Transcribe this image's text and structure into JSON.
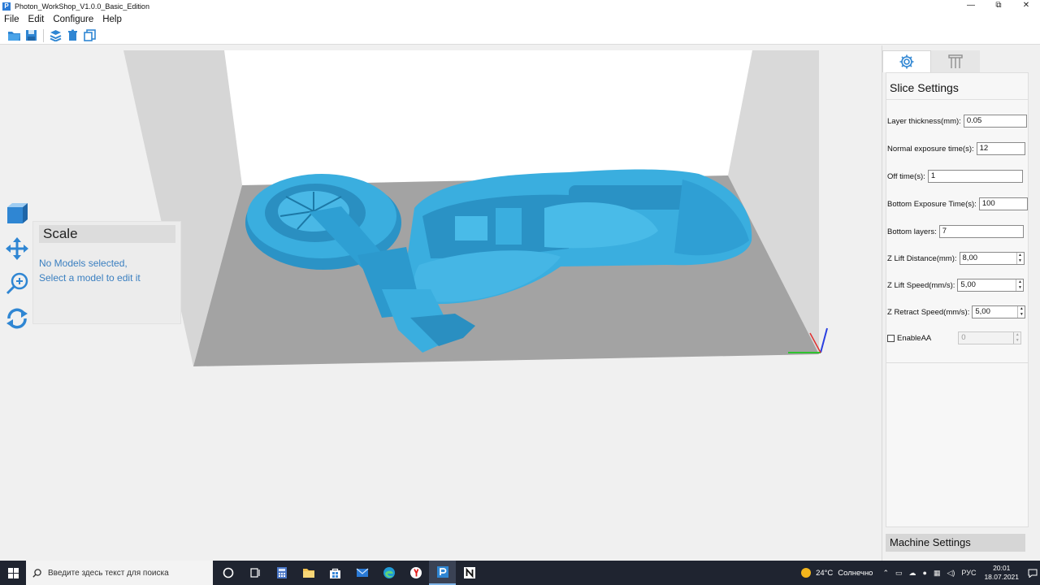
{
  "window": {
    "title": "Photon_WorkShop_V1.0.0_Basic_Edition",
    "app_icon_letter": "P",
    "controls": {
      "minimize": "—",
      "restore": "⧉",
      "close": "✕"
    }
  },
  "menu": {
    "items": [
      "File",
      "Edit",
      "Configure",
      "Help"
    ]
  },
  "toolbar": {
    "icons": [
      "open-folder-icon",
      "save-icon",
      "slice-layers-icon",
      "delete-icon",
      "copy-icon"
    ]
  },
  "left_tools": {
    "icons": [
      "cube-view-icon",
      "move-icon",
      "scale-icon",
      "rotate-icon"
    ]
  },
  "scale_panel": {
    "title": "Scale",
    "message_line1": "No Models selected,",
    "message_line2": "Select a model to edit it"
  },
  "right_panel": {
    "tabs": [
      {
        "icon": "gear-icon",
        "active": true
      },
      {
        "icon": "support-icon",
        "active": false
      }
    ],
    "title": "Slice Settings",
    "fields": {
      "layer_thickness": {
        "label": "Layer thickness(mm):",
        "value": "0.05"
      },
      "normal_exposure": {
        "label": "Normal exposure time(s):",
        "value": "12"
      },
      "off_time": {
        "label": "Off time(s):",
        "value": "1"
      },
      "bottom_exposure": {
        "label": "Bottom Exposure Time(s):",
        "value": "100"
      },
      "bottom_layers": {
        "label": "Bottom layers:",
        "value": "7"
      },
      "z_lift_distance": {
        "label": "Z Lift Distance(mm):",
        "value": "8,00"
      },
      "z_lift_speed": {
        "label": "Z Lift Speed(mm/s):",
        "value": "5,00"
      },
      "z_retract_speed": {
        "label": "Z Retract Speed(mm/s):",
        "value": "5,00"
      },
      "enable_aa": {
        "label": "EnableAA",
        "checked": false,
        "value": "0"
      }
    },
    "machine_settings_label": "Machine Settings"
  },
  "taskbar": {
    "search_placeholder": "Введите здесь текст для поиска",
    "apps": [
      "cortana-icon",
      "task-view-icon",
      "calculator-icon",
      "file-explorer-icon",
      "store-icon",
      "mail-icon",
      "edge-icon",
      "yandex-icon",
      "photon-icon",
      "notion-icon"
    ],
    "active_app": "photon-icon",
    "weather_temp": "24°C",
    "weather_text": "Солнечно",
    "language": "РУС",
    "time": "20:01",
    "date": "18.07.2021"
  },
  "colors": {
    "model": "#39a8d8",
    "model_dark": "#1f7fae",
    "build_plate": "#a2a2a2",
    "walls": "#d4d4d4",
    "accent": "#2b7bd6"
  }
}
